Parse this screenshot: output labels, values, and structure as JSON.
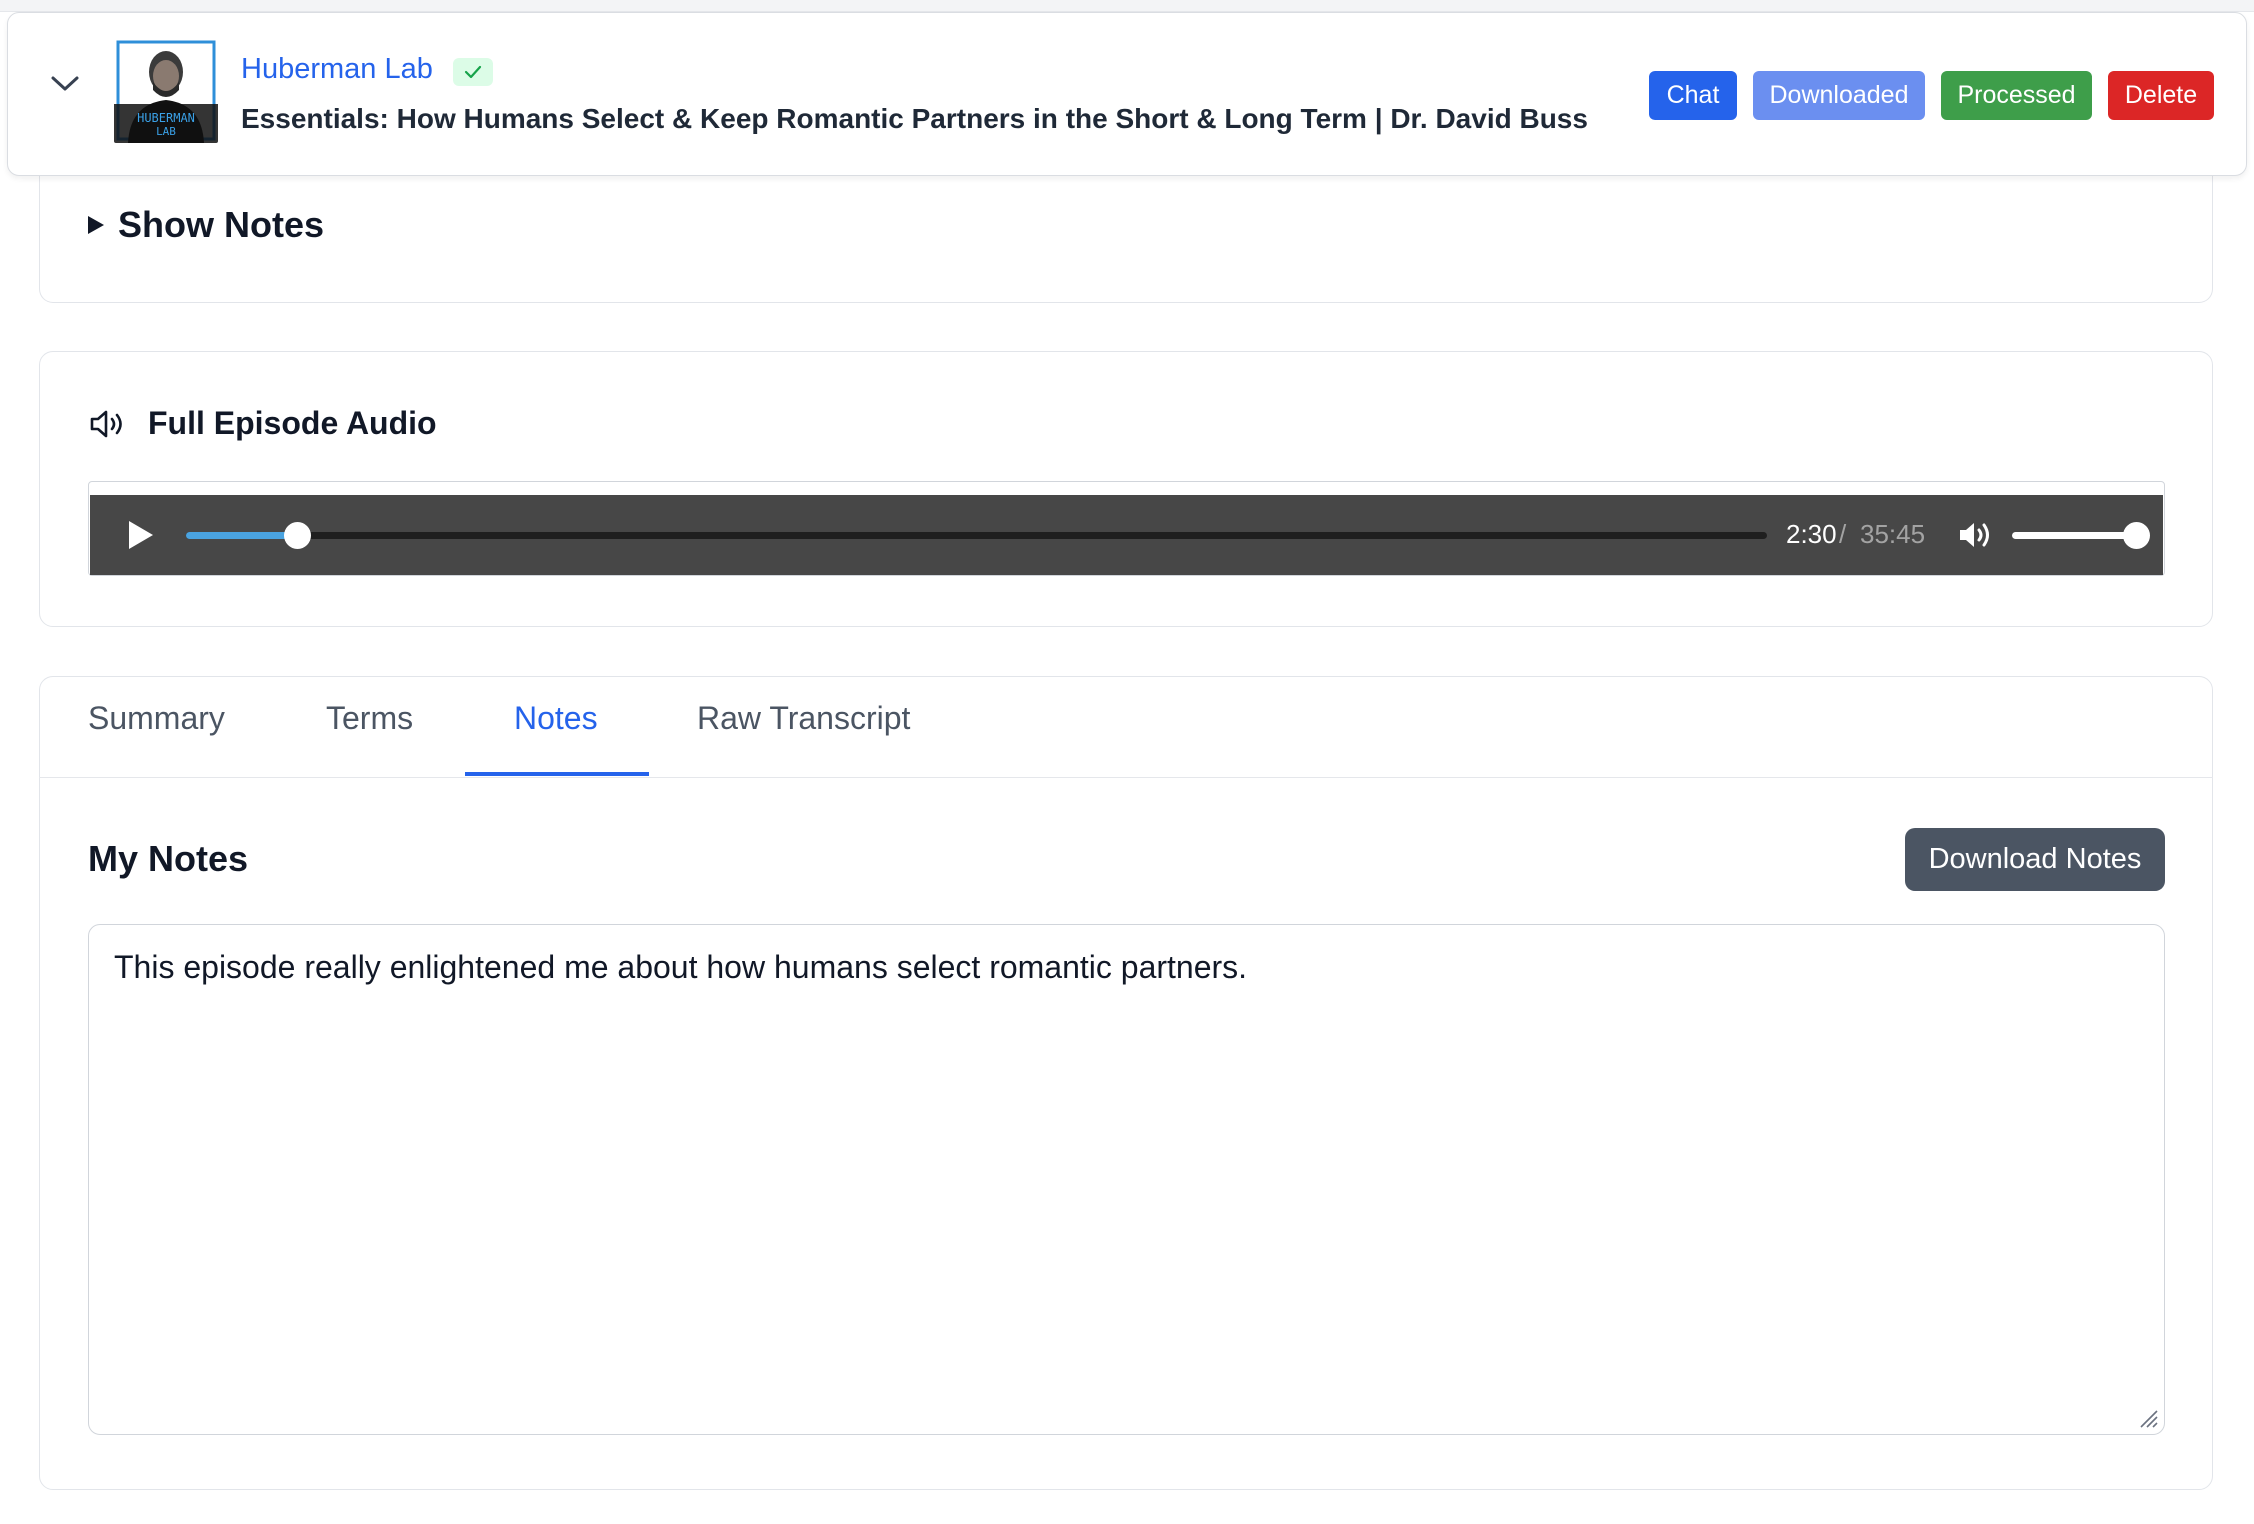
{
  "episode": {
    "podcast_name": "Huberman Lab",
    "title": "Essentials: How Humans Select & Keep Romantic Partners in the Short & Long Term | Dr. David Buss",
    "cover_text": "HUBERMAN LAB",
    "verified_icon": "check-icon",
    "actions": {
      "chat": "Chat",
      "downloaded": "Downloaded",
      "processed": "Processed",
      "delete": "Delete"
    }
  },
  "show_notes": {
    "label": "Show Notes"
  },
  "audio": {
    "heading": "Full Episode Audio",
    "icon": "speaker-icon",
    "current_time": "2:30",
    "separator": "/",
    "total_time": "35:45",
    "progress_fraction": 0.07,
    "volume_fraction": 1.0
  },
  "tabs": [
    {
      "label": "Summary",
      "active": false
    },
    {
      "label": "Terms",
      "active": false
    },
    {
      "label": "Notes",
      "active": true
    },
    {
      "label": "Raw Transcript",
      "active": false
    }
  ],
  "notes": {
    "heading": "My Notes",
    "download_label": "Download Notes",
    "text": "This episode really enlightened me about how humans select romantic partners."
  },
  "colors": {
    "link_blue": "#2563eb",
    "downloaded": "#6b8ff0",
    "processed": "#3e9e4a",
    "delete": "#dc2626",
    "player_bg": "#474747",
    "seek_fill": "#4aa3e0"
  }
}
